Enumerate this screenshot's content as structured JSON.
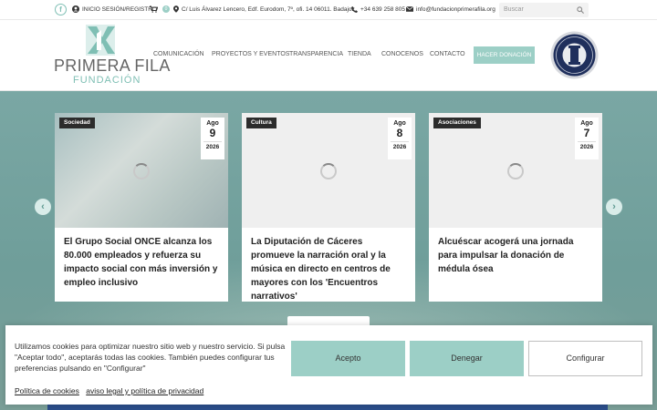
{
  "topbar": {
    "facebook": "f",
    "login": "INICIO SESIÓN/REGISTRO",
    "cart_count": "0",
    "address": "C/ Luis Álvarez Lencero, Edf. Eurodom, 7º, ofi. 14 06011. Badajoz",
    "phone": "+34 639 258 805",
    "email": "info@fundacionprimerafila.org",
    "search_placeholder": "Buscar"
  },
  "brand": {
    "title": "PRIMERA FILA",
    "subtitle": "FUNDACIÓN",
    "accent": "#9ccfc6"
  },
  "nav": {
    "items": [
      "COMUNICACIÓN",
      "PROYECTOS Y EVENTOS",
      "TRANSPARENCIA",
      "TIENDA",
      "CONOCENOS",
      "CONTACTO"
    ],
    "cta": "HACER DONACIÓN"
  },
  "cards": [
    {
      "category": "Sociedad",
      "month": "Ago",
      "day": "9",
      "year": "2026",
      "title": "El Grupo Social ONCE alcanza los 80.000 empleados y refuerza su impacto social con más inversión y empleo inclusivo"
    },
    {
      "category": "Cultura",
      "month": "Ago",
      "day": "8",
      "year": "2026",
      "title": "La Diputación de Cáceres promueve la narración oral y la música en directo en centros de mayores con los 'Encuentros narrativos'"
    },
    {
      "category": "Asociaciones",
      "month": "Ago",
      "day": "7",
      "year": "2026",
      "title": "Alcuéscar acogerá una jornada para impulsar la donación de médula ósea"
    }
  ],
  "cookie": {
    "text": "Utilizamos cookies para optimizar nuestro sitio web y nuestro servicio. Si pulsa \"Aceptar todo\", aceptarás todas las cookies. También puedes configurar tus preferencias pulsando en \"Configurar\"",
    "accept": "Acepto",
    "deny": "Denegar",
    "configure": "Configurar",
    "link_policy": "Política de cookies",
    "link_legal": "aviso legal y política de privacidad"
  }
}
